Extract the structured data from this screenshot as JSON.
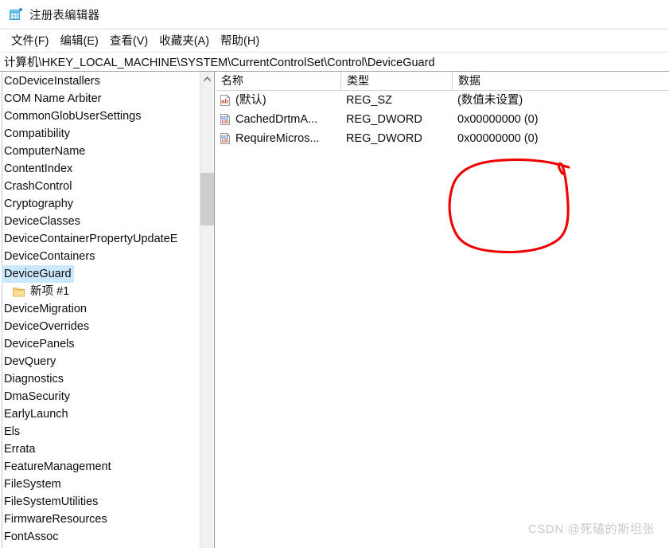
{
  "window": {
    "title": "注册表编辑器",
    "icon": "registry-editor-icon"
  },
  "menubar": {
    "items": [
      {
        "label": "文件(F)",
        "name": "menu-file"
      },
      {
        "label": "编辑(E)",
        "name": "menu-edit"
      },
      {
        "label": "查看(V)",
        "name": "menu-view"
      },
      {
        "label": "收藏夹(A)",
        "name": "menu-favorites"
      },
      {
        "label": "帮助(H)",
        "name": "menu-help"
      }
    ]
  },
  "address": {
    "path": "计算机\\HKEY_LOCAL_MACHINE\\SYSTEM\\CurrentControlSet\\Control\\DeviceGuard"
  },
  "tree": {
    "items": [
      {
        "label": "CoDeviceInstallers",
        "selected": false,
        "child": false
      },
      {
        "label": "COM Name Arbiter",
        "selected": false,
        "child": false
      },
      {
        "label": "CommonGlobUserSettings",
        "selected": false,
        "child": false
      },
      {
        "label": "Compatibility",
        "selected": false,
        "child": false
      },
      {
        "label": "ComputerName",
        "selected": false,
        "child": false
      },
      {
        "label": "ContentIndex",
        "selected": false,
        "child": false
      },
      {
        "label": "CrashControl",
        "selected": false,
        "child": false
      },
      {
        "label": "Cryptography",
        "selected": false,
        "child": false
      },
      {
        "label": "DeviceClasses",
        "selected": false,
        "child": false
      },
      {
        "label": "DeviceContainerPropertyUpdateE",
        "selected": false,
        "child": false
      },
      {
        "label": "DeviceContainers",
        "selected": false,
        "child": false
      },
      {
        "label": "DeviceGuard",
        "selected": true,
        "child": false
      },
      {
        "label": "新项 #1",
        "selected": false,
        "child": true
      },
      {
        "label": "DeviceMigration",
        "selected": false,
        "child": false
      },
      {
        "label": "DeviceOverrides",
        "selected": false,
        "child": false
      },
      {
        "label": "DevicePanels",
        "selected": false,
        "child": false
      },
      {
        "label": "DevQuery",
        "selected": false,
        "child": false
      },
      {
        "label": "Diagnostics",
        "selected": false,
        "child": false
      },
      {
        "label": "DmaSecurity",
        "selected": false,
        "child": false
      },
      {
        "label": "EarlyLaunch",
        "selected": false,
        "child": false
      },
      {
        "label": "Els",
        "selected": false,
        "child": false
      },
      {
        "label": "Errata",
        "selected": false,
        "child": false
      },
      {
        "label": "FeatureManagement",
        "selected": false,
        "child": false
      },
      {
        "label": "FileSystem",
        "selected": false,
        "child": false
      },
      {
        "label": "FileSystemUtilities",
        "selected": false,
        "child": false
      },
      {
        "label": "FirmwareResources",
        "selected": false,
        "child": false
      },
      {
        "label": "FontAssoc",
        "selected": false,
        "child": false
      }
    ]
  },
  "values": {
    "columns": [
      {
        "label": "名称",
        "name": "column-header-name"
      },
      {
        "label": "类型",
        "name": "column-header-type"
      },
      {
        "label": "数据",
        "name": "column-header-data"
      }
    ],
    "rows": [
      {
        "name": "(默认)",
        "type": "REG_SZ",
        "data": "(数值未设置)",
        "icon": "string-value-icon"
      },
      {
        "name": "CachedDrtmA...",
        "type": "REG_DWORD",
        "data": "0x00000000 (0)",
        "icon": "dword-value-icon"
      },
      {
        "name": "RequireMicros...",
        "type": "REG_DWORD",
        "data": "0x00000000 (0)",
        "icon": "dword-value-icon"
      }
    ]
  },
  "annotation": {
    "color": "#ee0000",
    "shape": "hand-drawn-circle"
  },
  "watermark": {
    "text": "CSDN @死磕的斯坦张"
  },
  "colors": {
    "selection": "#cce8ff",
    "annotation_red": "#ee0000",
    "scrollbar_thumb": "#cdcdcd"
  }
}
